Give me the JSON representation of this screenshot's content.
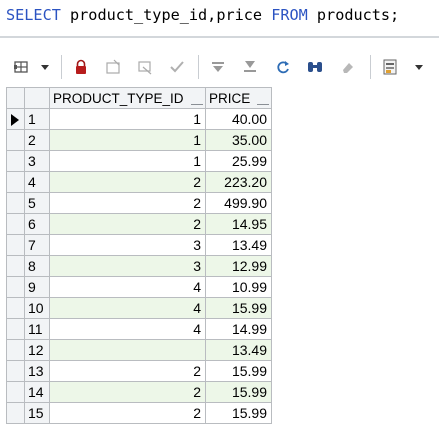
{
  "editor": {
    "kw_select": "SELECT",
    "columns_text": " product_type_id,price ",
    "kw_from": "FROM",
    "table_text": " products;"
  },
  "toolbar": {
    "icons": [
      "grid-options-icon",
      "dropdown-icon",
      "lock-icon",
      "insert-row-icon",
      "delete-row-icon",
      "post-edit-icon",
      "filter-first-icon",
      "filter-last-icon",
      "refresh-icon",
      "find-icon",
      "clear-icon",
      "export-icon",
      "export-dropdown-icon"
    ]
  },
  "grid": {
    "columns": [
      "PRODUCT_TYPE_ID",
      "PRICE"
    ],
    "rows": [
      {
        "num": "1",
        "product_type_id": "1",
        "price": "40.00"
      },
      {
        "num": "2",
        "product_type_id": "1",
        "price": "35.00"
      },
      {
        "num": "3",
        "product_type_id": "1",
        "price": "25.99"
      },
      {
        "num": "4",
        "product_type_id": "2",
        "price": "223.20"
      },
      {
        "num": "5",
        "product_type_id": "2",
        "price": "499.90"
      },
      {
        "num": "6",
        "product_type_id": "2",
        "price": "14.95"
      },
      {
        "num": "7",
        "product_type_id": "3",
        "price": "13.49"
      },
      {
        "num": "8",
        "product_type_id": "3",
        "price": "12.99"
      },
      {
        "num": "9",
        "product_type_id": "4",
        "price": "10.99"
      },
      {
        "num": "10",
        "product_type_id": "4",
        "price": "15.99"
      },
      {
        "num": "11",
        "product_type_id": "4",
        "price": "14.99"
      },
      {
        "num": "12",
        "product_type_id": "",
        "price": "13.49"
      },
      {
        "num": "13",
        "product_type_id": "2",
        "price": "15.99"
      },
      {
        "num": "14",
        "product_type_id": "2",
        "price": "15.99"
      },
      {
        "num": "15",
        "product_type_id": "2",
        "price": "15.99"
      }
    ],
    "colors": {
      "alt_row": "#edf7e8",
      "header_bg": "#f2f4f6",
      "grid_line": "#b9bcc0",
      "keyword": "#2b53c2"
    }
  }
}
